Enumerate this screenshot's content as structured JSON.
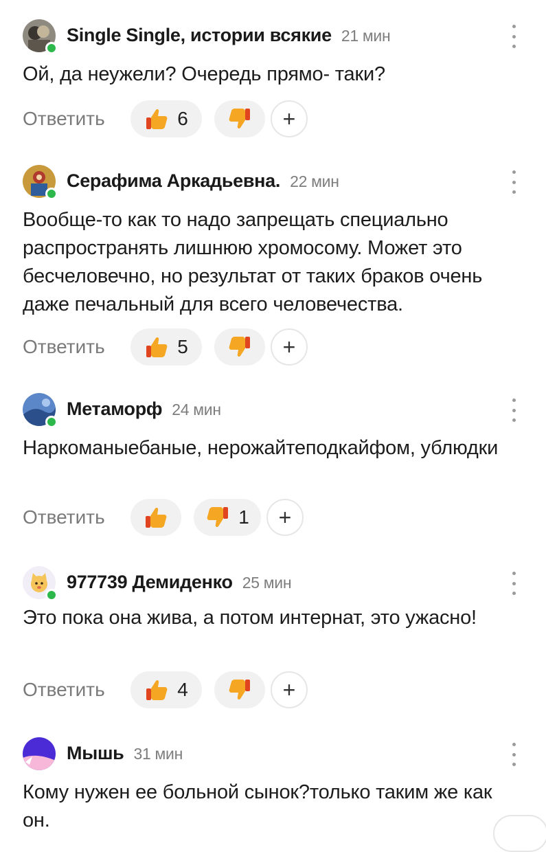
{
  "comments": [
    {
      "author": "Single Single, истории всякие",
      "time": "21 мин",
      "text": "Ой, да неужели? Очередь прямо- таки?",
      "likes": "6",
      "dislikes": ""
    },
    {
      "author": "Серафима Аркадьевна.",
      "time": "22 мин",
      "text": "Вообще-то как то надо запрещать специально распространять лишнюю хромосому. Может это бесчеловечно, но результат от таких браков очень даже печальный для всего человечества.",
      "likes": "5",
      "dislikes": ""
    },
    {
      "author": "Метаморф",
      "time": "24 мин",
      "text": "Наркоманыебаные, нерожайтеподкайфом, ублюдки",
      "likes": "",
      "dislikes": "1"
    },
    {
      "author": "977739 Демиденко",
      "time": "25 мин",
      "text": "Это пока она жива, а потом интернат, это ужасно!",
      "likes": "4",
      "dislikes": ""
    },
    {
      "author": "Мышь",
      "time": "31 мин",
      "text": "Кому нужен ее больной сынок?только таким же как он.",
      "likes": "",
      "dislikes": ""
    }
  ],
  "actions": {
    "reply_label": "Ответить",
    "add_reaction_label": "+"
  },
  "colors": {
    "online": "#2db84b",
    "like_thumb": "#f5a623",
    "dislike_thumb": "#f5a623",
    "reply": "#7a7a7a",
    "pill_bg": "#f1f1f1"
  },
  "icons": {
    "like": "thumbs-up-icon",
    "dislike": "thumbs-down-icon",
    "more": "more-vertical-icon",
    "add": "plus-icon"
  }
}
